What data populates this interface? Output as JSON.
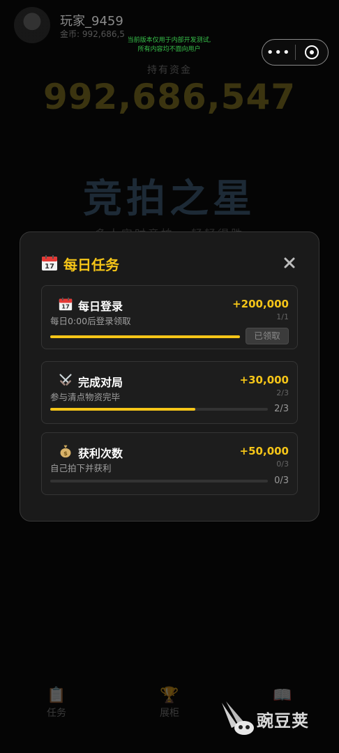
{
  "player": {
    "name": "玩家_9459",
    "gold_line": "金币: 992,686,5"
  },
  "dev_notice": {
    "line1": "当前版本仅用于内部开发测试,",
    "line2": "所有内容均不面向用户"
  },
  "capsule": {
    "more": "•••"
  },
  "funds": {
    "label": "持有资金",
    "value": "992,686,547"
  },
  "game": {
    "title": "竞拍之星",
    "subtitle": "多人实时竞拍 · 轻轻得胜"
  },
  "modal": {
    "title": "每日任务",
    "close_glyph": "✕",
    "tasks": [
      {
        "icon": "calendar-icon",
        "name": "每日登录",
        "desc": "每日0:00后登录领取",
        "reward": "+200,000",
        "count_small": "1/1",
        "progress": 1.0,
        "button": "已领取"
      },
      {
        "icon": "crossed-swords-icon",
        "name": "完成对局",
        "desc": "参与清点物资完毕",
        "reward": "+30,000",
        "count_small": "2/3",
        "progress": 0.6667,
        "count": "2/3"
      },
      {
        "icon": "money-bag-icon",
        "name": "获利次数",
        "desc": "自己拍下并获利",
        "reward": "+50,000",
        "count_small": "0/3",
        "progress": 0.0,
        "count": "0/3"
      }
    ]
  },
  "tabs": [
    {
      "label": "任务",
      "icon": "clipboard-icon"
    },
    {
      "label": "展柜",
      "icon": "trophy-icon"
    },
    {
      "label": "",
      "icon": "book-icon"
    }
  ],
  "watermark": {
    "text": "豌豆荚"
  },
  "colors": {
    "accent": "#f5c518",
    "modal_bg": "#1a1a1a",
    "dev_notice": "#37c04a"
  }
}
